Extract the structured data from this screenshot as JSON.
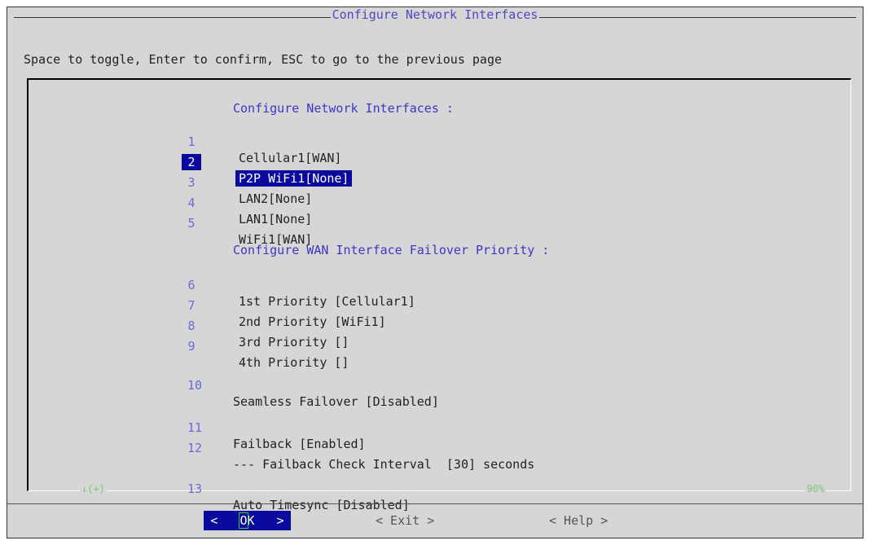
{
  "dialog": {
    "title": "Configure Network Interfaces",
    "hint": "Space to toggle, Enter to confirm, ESC to go to the previous page"
  },
  "menu": {
    "section_interfaces": "Configure Network Interfaces :",
    "items": [
      {
        "num": "1",
        "label": "Cellular1[WAN]"
      },
      {
        "num": "2",
        "label": "P2P WiFi1[None]",
        "selected": true
      },
      {
        "num": "3",
        "label": "LAN2[None]"
      },
      {
        "num": "4",
        "label": "LAN1[None]"
      },
      {
        "num": "5",
        "label": "WiFi1[WAN]"
      }
    ],
    "section_failover": "Configure WAN Interface Failover Priority :",
    "priorities": [
      {
        "num": "6",
        "label": "1st Priority [Cellular1]"
      },
      {
        "num": "7",
        "label": "2nd Priority [WiFi1]"
      },
      {
        "num": "8",
        "label": "3rd Priority []"
      },
      {
        "num": "9",
        "label": "4th Priority []"
      }
    ],
    "seamless": {
      "num": "10",
      "label": "Seamless Failover [Disabled]"
    },
    "failback": {
      "num": "11",
      "label": "Failback [Enabled]"
    },
    "failback_interval": {
      "num": "12",
      "label": "--- Failback Check Interval  [30] seconds"
    },
    "timesync": {
      "num": "13",
      "label": "Auto Timesync [Disabled]"
    }
  },
  "scroll": {
    "indicator": "↓(+)",
    "percent": "90%"
  },
  "buttons": {
    "ok_left": "<",
    "ok_hot": "O",
    "ok_rest": "K",
    "ok_right": ">",
    "exit": "< Exit >",
    "help": "< Help >"
  },
  "colors": {
    "selection": "#0a0a9e",
    "heading": "#3d36c6",
    "dialog_bg": "#d6d6d6"
  }
}
